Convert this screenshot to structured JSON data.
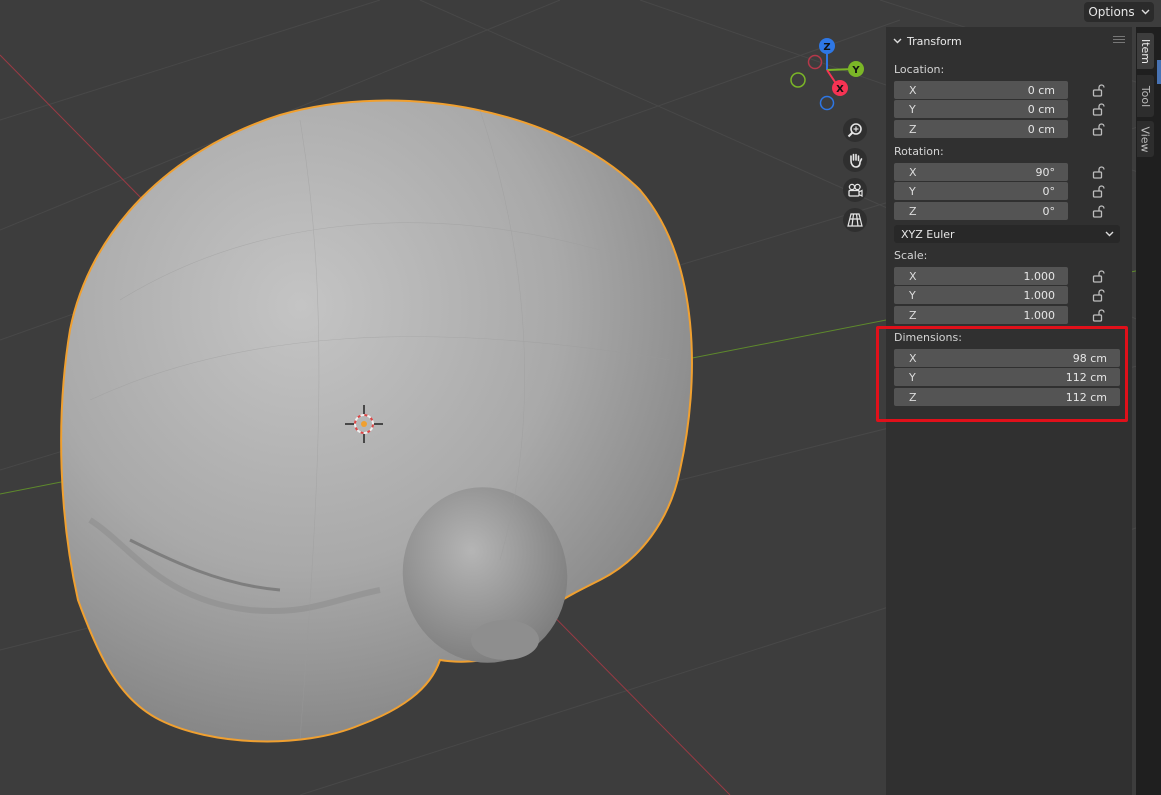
{
  "header": {
    "options_label": "Options"
  },
  "nav_gizmo": {
    "z_label": "Z",
    "y_label": "Y",
    "x_label": "X",
    "x_color": "#f63353",
    "y_color": "#7bb627",
    "z_color": "#2e77e5"
  },
  "viewport_nav": [
    "zoom-icon",
    "hand-pan-icon",
    "camera-icon",
    "grid-icon"
  ],
  "tabs": {
    "item": "Item",
    "tool": "Tool",
    "view": "View"
  },
  "transform": {
    "title": "Transform",
    "location": {
      "label": "Location:",
      "x_axis": "X",
      "x": "0 cm",
      "y_axis": "Y",
      "y": "0 cm",
      "z_axis": "Z",
      "z": "0 cm"
    },
    "rotation": {
      "label": "Rotation:",
      "x_axis": "X",
      "x": "90°",
      "y_axis": "Y",
      "y": "0°",
      "z_axis": "Z",
      "z": "0°",
      "mode": "XYZ Euler"
    },
    "scale": {
      "label": "Scale:",
      "x_axis": "X",
      "x": "1.000",
      "y_axis": "Y",
      "y": "1.000",
      "z_axis": "Z",
      "z": "1.000"
    },
    "dimensions": {
      "label": "Dimensions:",
      "x_axis": "X",
      "x": "98 cm",
      "y_axis": "Y",
      "y": "112 cm",
      "z_axis": "Z",
      "z": "112 cm"
    }
  },
  "colors": {
    "selection_outline": "#f0a030",
    "annotation_box": "#e0101a",
    "viewport_bg": "#3d3d3d"
  }
}
